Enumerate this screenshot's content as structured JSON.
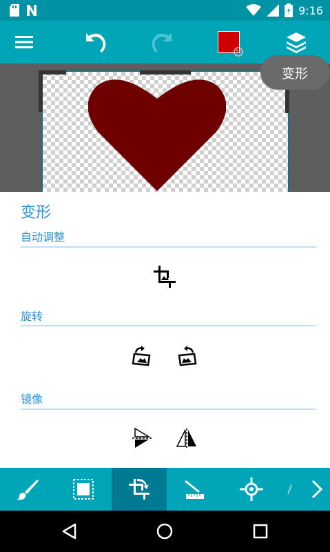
{
  "status_bar": {
    "time": "9:16",
    "left_icons": [
      "sd-card-icon",
      "notification-n-icon"
    ],
    "right_icons": [
      "wifi-icon",
      "signal-icon",
      "battery-icon"
    ]
  },
  "toolbar": {
    "buttons": [
      "menu-icon",
      "undo-icon",
      "redo-icon",
      "color-swatch",
      "layers-icon"
    ],
    "color": "#d10000"
  },
  "tooltip": {
    "text": "变形"
  },
  "panel": {
    "title": "变形",
    "sections": [
      {
        "label": "自动调整"
      },
      {
        "label": "旋转"
      },
      {
        "label": "镜像"
      }
    ]
  },
  "bottom_tools": [
    "brush-icon",
    "select-icon",
    "transform-icon",
    "line-icon",
    "move-icon",
    "next-icon"
  ],
  "nav": [
    "back-icon",
    "home-icon",
    "recents-icon"
  ],
  "colors": {
    "accent": "#00a5b8",
    "statusbar": "#0093a6",
    "section": "#2a8fd0",
    "heart": "#6e0000"
  }
}
